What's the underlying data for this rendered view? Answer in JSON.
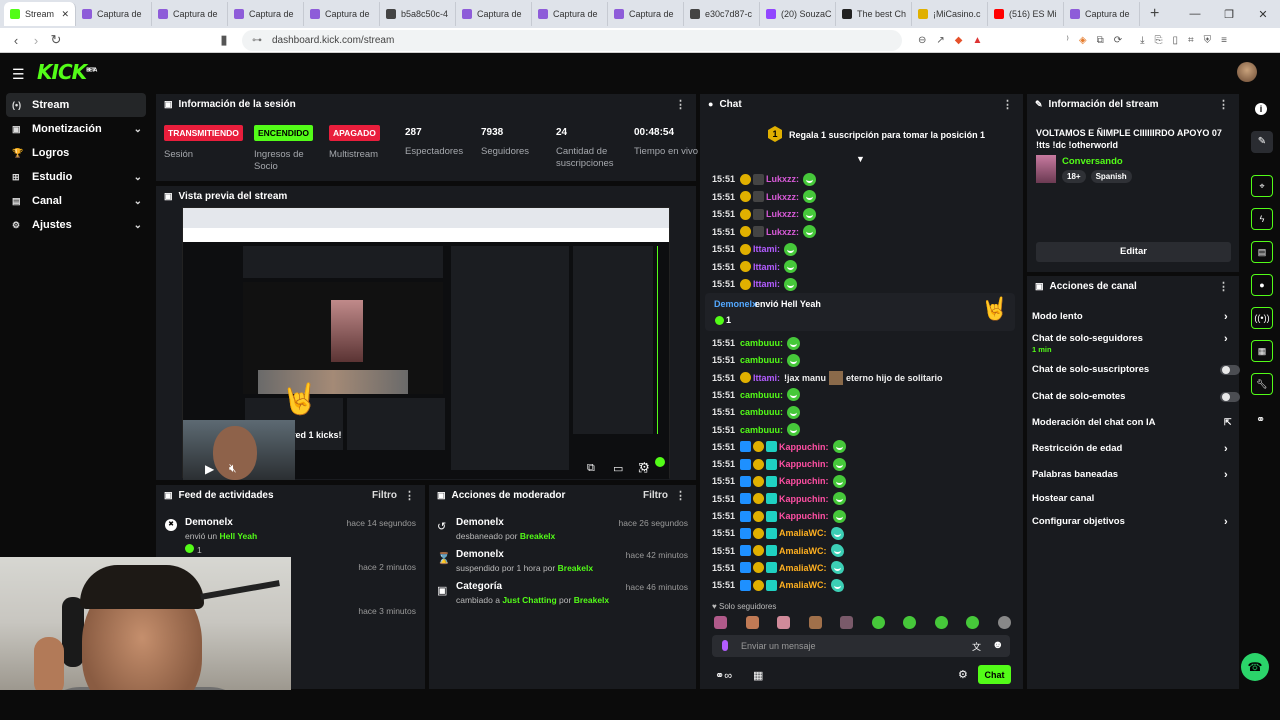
{
  "browser": {
    "tabs": [
      {
        "label": "Stream",
        "fav": "#53fc18"
      },
      {
        "label": "Captura de",
        "fav": "#8e5cd9"
      },
      {
        "label": "Captura de",
        "fav": "#8e5cd9"
      },
      {
        "label": "Captura de",
        "fav": "#8e5cd9"
      },
      {
        "label": "Captura de",
        "fav": "#8e5cd9"
      },
      {
        "label": "b5a8c50c-4",
        "fav": "#444"
      },
      {
        "label": "Captura de",
        "fav": "#8e5cd9"
      },
      {
        "label": "Captura de",
        "fav": "#8e5cd9"
      },
      {
        "label": "Captura de",
        "fav": "#8e5cd9"
      },
      {
        "label": "e30c7d87-c",
        "fav": "#444"
      },
      {
        "label": "(20) SouzaC",
        "fav": "#9146ff"
      },
      {
        "label": "The best Ch",
        "fav": "#222"
      },
      {
        "label": "¡MiCasino.c",
        "fav": "#e0b000"
      },
      {
        "label": "(516) ES Mi",
        "fav": "#ff0000"
      },
      {
        "label": "Captura de",
        "fav": "#8e5cd9"
      }
    ],
    "new_tab": "+",
    "url": "dashboard.kick.com/stream"
  },
  "app": {
    "logo": "KICK",
    "logo_sup": "BETA",
    "sidebar": [
      {
        "label": "Stream",
        "icon": "(•)",
        "active": true,
        "chevron": false
      },
      {
        "label": "Monetización",
        "icon": "▣",
        "chevron": true
      },
      {
        "label": "Logros",
        "icon": "🏆",
        "chevron": false
      },
      {
        "label": "Estudio",
        "icon": "⊞",
        "chevron": true
      },
      {
        "label": "Canal",
        "icon": "▤",
        "chevron": true
      },
      {
        "label": "Ajustes",
        "icon": "⚙",
        "chevron": true
      }
    ]
  },
  "session": {
    "title": "Información de la sesión",
    "stats": [
      {
        "value": "TRANSMITIENDO",
        "label": "Sesión",
        "badge": "#e91e3c",
        "fg": "#fff"
      },
      {
        "value": "ENCENDIDO",
        "label": "Ingresos de Socio",
        "badge": "#53fc18",
        "fg": "#000"
      },
      {
        "value": "APAGADO",
        "label": "Multistream",
        "badge": "#e91e3c",
        "fg": "#fff"
      },
      {
        "value": "287",
        "label": "Espectadores"
      },
      {
        "value": "7938",
        "label": "Seguidores"
      },
      {
        "value": "24",
        "label": "Cantidad de suscripciones"
      },
      {
        "value": "00:48:54",
        "label": "Tiempo en vivo"
      }
    ]
  },
  "preview": {
    "title": "Vista previa del stream",
    "overlay_text": "ered 1 kicks!"
  },
  "feed": {
    "title": "Feed de actividades",
    "filter": "Filtro",
    "items": [
      {
        "user": "Demonelx",
        "text": "envió un",
        "gift": "Hell Yeah",
        "count": "1",
        "time": "hace 14 segundos"
      },
      {
        "user": "",
        "text": "",
        "gift": "",
        "count": "",
        "time": "hace 2 minutos"
      },
      {
        "user": "",
        "text": "",
        "gift": "",
        "count": "",
        "time": "hace 3 minutos"
      }
    ]
  },
  "modactions": {
    "title": "Acciones de moderador",
    "filter": "Filtro",
    "items": [
      {
        "user": "Demonelx",
        "action": "desbaneado por",
        "by": "Breakelx",
        "time": "hace 26 segundos",
        "icon": "↺"
      },
      {
        "user": "Demonelx",
        "action": "suspendido por 1 hora por",
        "by": "Breakelx",
        "time": "hace 42 minutos",
        "icon": "⌛"
      },
      {
        "user": "Categoría",
        "action": "cambiado a",
        "target": "Just Chatting",
        "mid": "por",
        "by": "Breakelx",
        "time": "hace 46 minutos",
        "icon": "▣"
      }
    ]
  },
  "chat": {
    "title": "Chat",
    "pinned": "Regala 1 suscripción para tomar la posición 1",
    "pinned_rank": "1",
    "messages": [
      {
        "time": "15:51",
        "user": "Lukxzz:",
        "color": "#d65ad6",
        "badges": [
          "#e0b000",
          "#444"
        ],
        "emote": "cool"
      },
      {
        "time": "15:51",
        "user": "Lukxzz:",
        "color": "#d65ad6",
        "badges": [
          "#e0b000",
          "#444"
        ],
        "emote": "cool"
      },
      {
        "time": "15:51",
        "user": "Lukxzz:",
        "color": "#d65ad6",
        "badges": [
          "#e0b000",
          "#444"
        ],
        "emote": "cool"
      },
      {
        "time": "15:51",
        "user": "Lukxzz:",
        "color": "#d65ad6",
        "badges": [
          "#e0b000",
          "#444"
        ],
        "emote": "cool"
      },
      {
        "time": "15:51",
        "user": "Ittami:",
        "color": "#b35cff",
        "badges": [
          "#e0b000"
        ],
        "emote": "cool"
      },
      {
        "time": "15:51",
        "user": "Ittami:",
        "color": "#b35cff",
        "badges": [
          "#e0b000"
        ],
        "emote": "cool"
      },
      {
        "time": "15:51",
        "user": "Ittami:",
        "color": "#b35cff",
        "badges": [
          "#e0b000"
        ],
        "emote": "cool"
      }
    ],
    "gift_msg": {
      "user": "Demonelx",
      "text": "envió Hell Yeah",
      "count": "1"
    },
    "messages2": [
      {
        "time": "15:51",
        "user": "cambuuu:",
        "color": "#53fc18",
        "badges": [],
        "emote": "cool"
      },
      {
        "time": "15:51",
        "user": "cambuuu:",
        "color": "#53fc18",
        "badges": [],
        "emote": "cool"
      },
      {
        "time": "15:51",
        "user": "Ittami:",
        "color": "#b35cff",
        "badges": [
          "#e0b000"
        ],
        "text": "!jax manu",
        "text2": "eterno hijo de solitario"
      },
      {
        "time": "15:51",
        "user": "cambuuu:",
        "color": "#53fc18",
        "badges": [],
        "emote": "cool"
      },
      {
        "time": "15:51",
        "user": "cambuuu:",
        "color": "#53fc18",
        "badges": [],
        "emote": "cool"
      },
      {
        "time": "15:51",
        "user": "cambuuu:",
        "color": "#53fc18",
        "badges": [],
        "emote": "cool"
      },
      {
        "time": "15:51",
        "user": "Kappuchin:",
        "color": "#ff4fa3",
        "badges": [
          "#1e90ff",
          "#e0b000",
          "#1fd1c2"
        ],
        "emote": "cool"
      },
      {
        "time": "15:51",
        "user": "Kappuchin:",
        "color": "#ff4fa3",
        "badges": [
          "#1e90ff",
          "#e0b000",
          "#1fd1c2"
        ],
        "emote": "cool"
      },
      {
        "time": "15:51",
        "user": "Kappuchin:",
        "color": "#ff4fa3",
        "badges": [
          "#1e90ff",
          "#e0b000",
          "#1fd1c2"
        ],
        "emote": "cool"
      },
      {
        "time": "15:51",
        "user": "Kappuchin:",
        "color": "#ff4fa3",
        "badges": [
          "#1e90ff",
          "#e0b000",
          "#1fd1c2"
        ],
        "emote": "cool"
      },
      {
        "time": "15:51",
        "user": "Kappuchin:",
        "color": "#ff4fa3",
        "badges": [
          "#1e90ff",
          "#e0b000",
          "#1fd1c2"
        ],
        "emote": "cool"
      },
      {
        "time": "15:51",
        "user": "AmaliaWC:",
        "color": "#ffb020",
        "badges": [
          "#1e90ff",
          "#e0b000",
          "#1fd1c2"
        ],
        "emote": "fish"
      },
      {
        "time": "15:51",
        "user": "AmaliaWC:",
        "color": "#ffb020",
        "badges": [
          "#1e90ff",
          "#e0b000",
          "#1fd1c2"
        ],
        "emote": "fish"
      },
      {
        "time": "15:51",
        "user": "AmaliaWC:",
        "color": "#ffb020",
        "badges": [
          "#1e90ff",
          "#e0b000",
          "#1fd1c2"
        ],
        "emote": "fish"
      },
      {
        "time": "15:51",
        "user": "AmaliaWC:",
        "color": "#ffb020",
        "badges": [
          "#1e90ff",
          "#e0b000",
          "#1fd1c2"
        ],
        "emote": "fish"
      }
    ],
    "followers_only": "Solo seguidores",
    "placeholder": "Enviar un mensaje",
    "send": "Chat"
  },
  "stream_info": {
    "title": "Información del stream",
    "stream_title": "VOLTAMOS E ÑIMPLE CIIIIIIRDO APOYO 07 !tts !dc !otherworld",
    "category": "Conversando",
    "tags": [
      "18+",
      "Spanish"
    ],
    "edit": "Editar"
  },
  "channel_actions": {
    "title": "Acciones de canal",
    "items": [
      {
        "label": "Modo lento",
        "sub": "",
        "ctl": "chev"
      },
      {
        "label": "Chat de solo-seguidores",
        "sub": "1 min",
        "ctl": "chev"
      },
      {
        "label": "Chat de solo-suscriptores",
        "sub": "",
        "ctl": "toggle"
      },
      {
        "label": "Chat de solo-emotes",
        "sub": "",
        "ctl": "toggle"
      },
      {
        "label": "Moderación del chat con IA",
        "sub": "",
        "ctl": "ext"
      },
      {
        "label": "Restricción de edad",
        "sub": "",
        "ctl": "chev"
      },
      {
        "label": "Palabras baneadas",
        "sub": "",
        "ctl": "chev"
      },
      {
        "label": "Hostear canal",
        "sub": "",
        "ctl": "none"
      },
      {
        "label": "Configurar objetivos",
        "sub": "",
        "ctl": "chev"
      }
    ]
  }
}
